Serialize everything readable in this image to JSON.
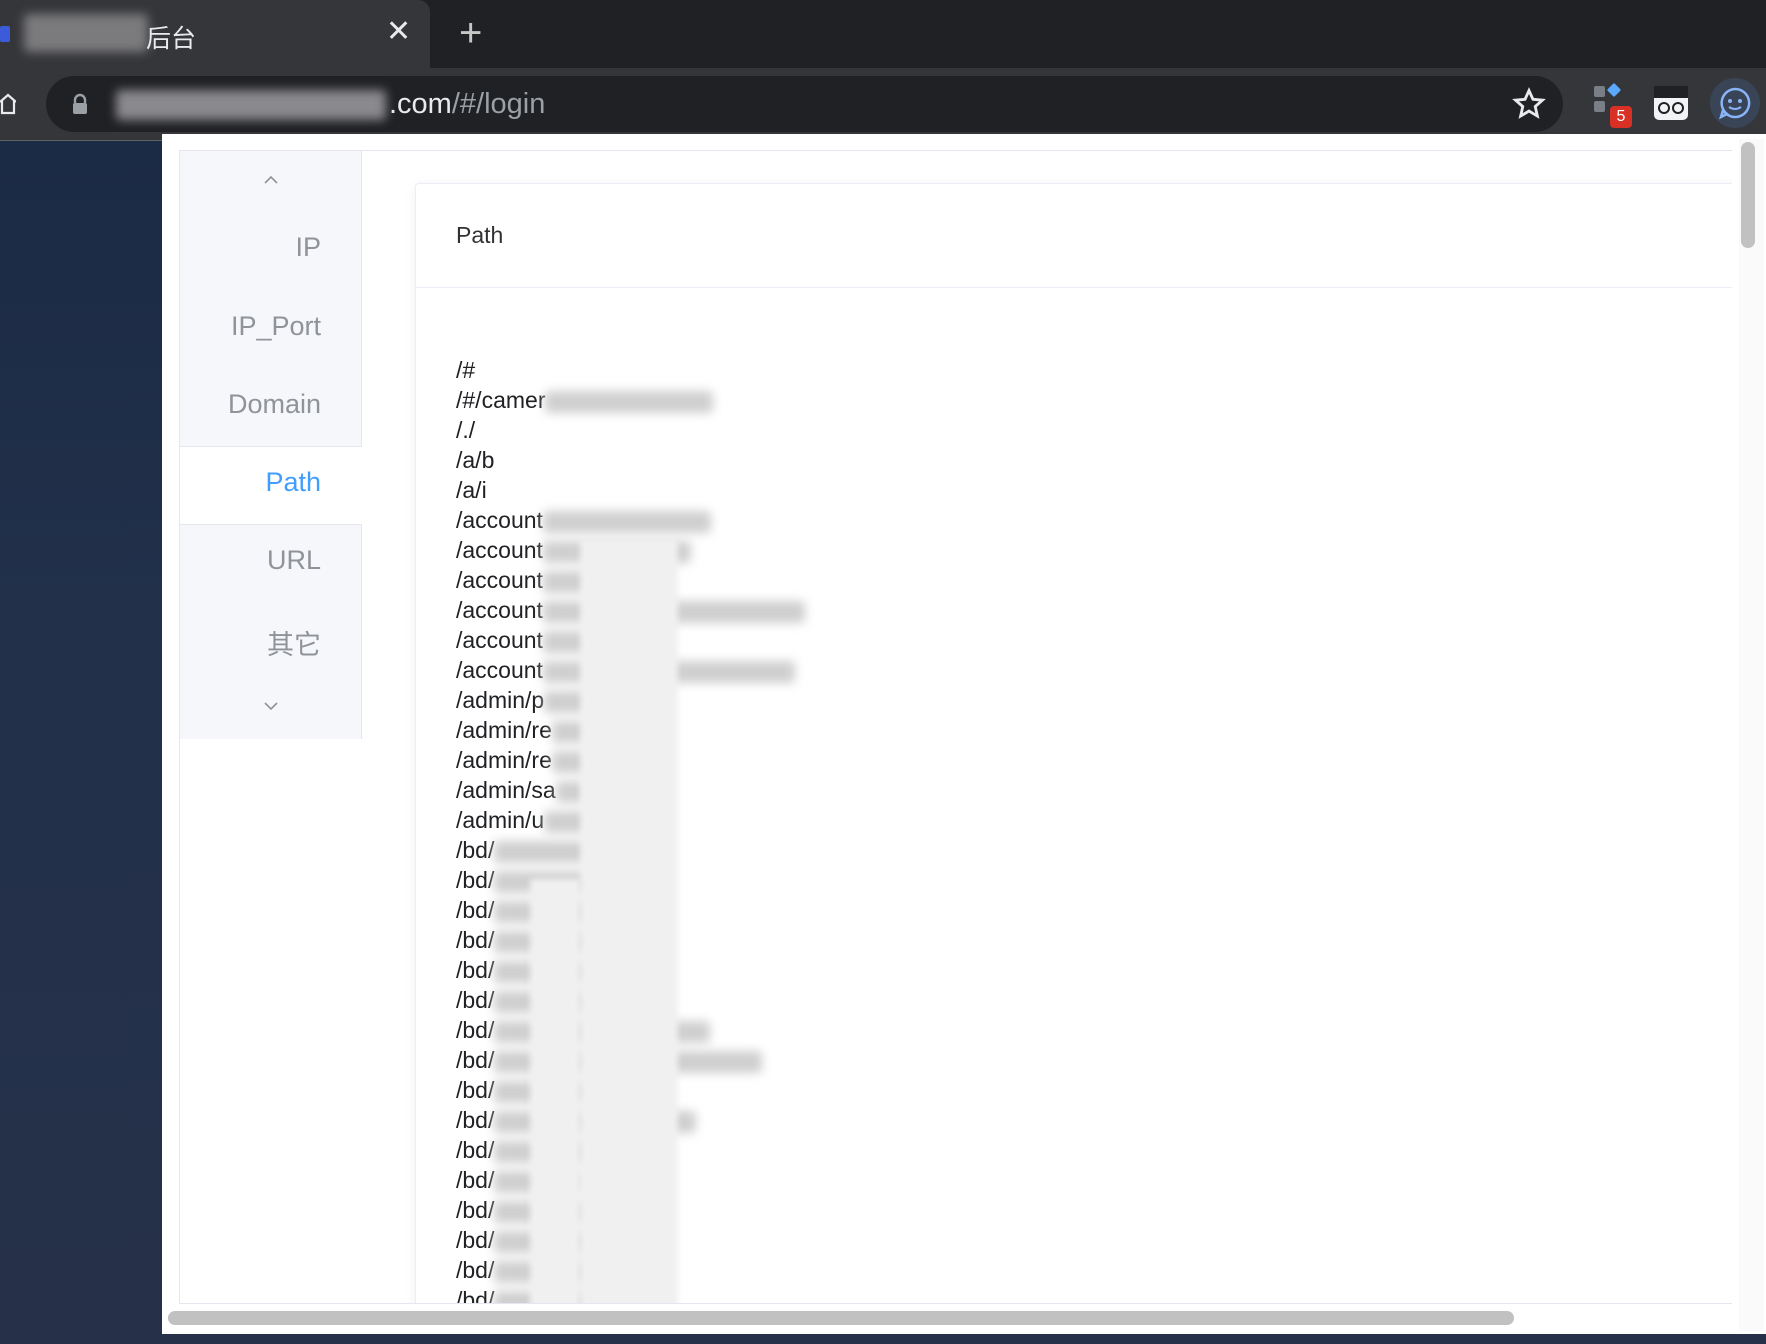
{
  "browser": {
    "tab_title": "后台",
    "tab_close_glyph": "✕",
    "new_tab_glyph": "+",
    "url_suffix": ".com",
    "url_route": "/#/login",
    "extension_badge": "5"
  },
  "sidebar": {
    "items": [
      {
        "label": "IP"
      },
      {
        "label": "IP_Port"
      },
      {
        "label": "Domain"
      },
      {
        "label": "Path",
        "active": true
      },
      {
        "label": "URL"
      },
      {
        "label": "其它"
      }
    ],
    "active_color": "#409eff",
    "inactive_color": "#909399"
  },
  "card": {
    "title": "Path"
  },
  "paths": [
    "/#",
    "/#/camer",
    "/./",
    "/a/b",
    "/a/i",
    "/account",
    "/account",
    "/account",
    "/account",
    "/account",
    "/account",
    "/admin/p",
    "/admin/re",
    "/admin/re",
    "/admin/sa",
    "/admin/u",
    "/bd/",
    "/bd/",
    "/bd/",
    "/bd/",
    "/bd/",
    "/bd/",
    "/bd/",
    "/bd/",
    "/bd/",
    "/bd/",
    "/bd/",
    "/bd/",
    "/bd/",
    "/bd/",
    "/bd/",
    "/bd/"
  ]
}
